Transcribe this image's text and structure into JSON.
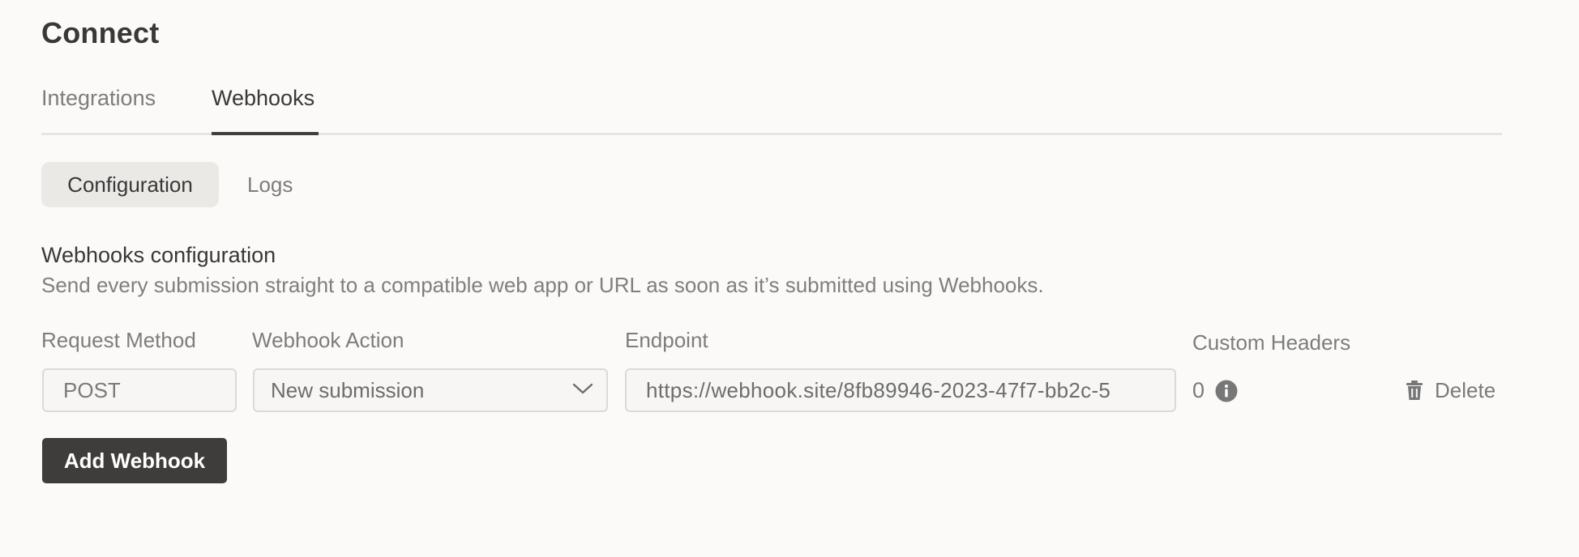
{
  "page": {
    "title": "Connect"
  },
  "tabs": [
    {
      "label": "Integrations",
      "active": false
    },
    {
      "label": "Webhooks",
      "active": true
    }
  ],
  "subtabs": [
    {
      "label": "Configuration",
      "active": true
    },
    {
      "label": "Logs",
      "active": false
    }
  ],
  "section": {
    "title": "Webhooks configuration",
    "description": "Send every submission straight to a compatible web app or URL as soon as it’s submitted using Webhooks."
  },
  "columns": {
    "method": "Request Method",
    "action": "Webhook Action",
    "endpoint": "Endpoint",
    "headers": "Custom Headers"
  },
  "webhook": {
    "method": "POST",
    "action": "New submission",
    "endpoint": "https://webhook.site/8fb89946-2023-47f7-bb2c-5",
    "custom_headers_count": "0",
    "delete_label": "Delete"
  },
  "buttons": {
    "add_webhook": "Add Webhook"
  },
  "icons": {
    "action_dropdown": "chevron-down-icon",
    "headers_info": "info-icon",
    "delete": "trash-icon"
  },
  "colors": {
    "background": "#fbfaf9",
    "primary_button": "#3e3d3b",
    "active_tab_underline": "#3f3f3f",
    "active_subtab_bg": "#ebe9e6",
    "muted_text": "#7d7d7d"
  }
}
